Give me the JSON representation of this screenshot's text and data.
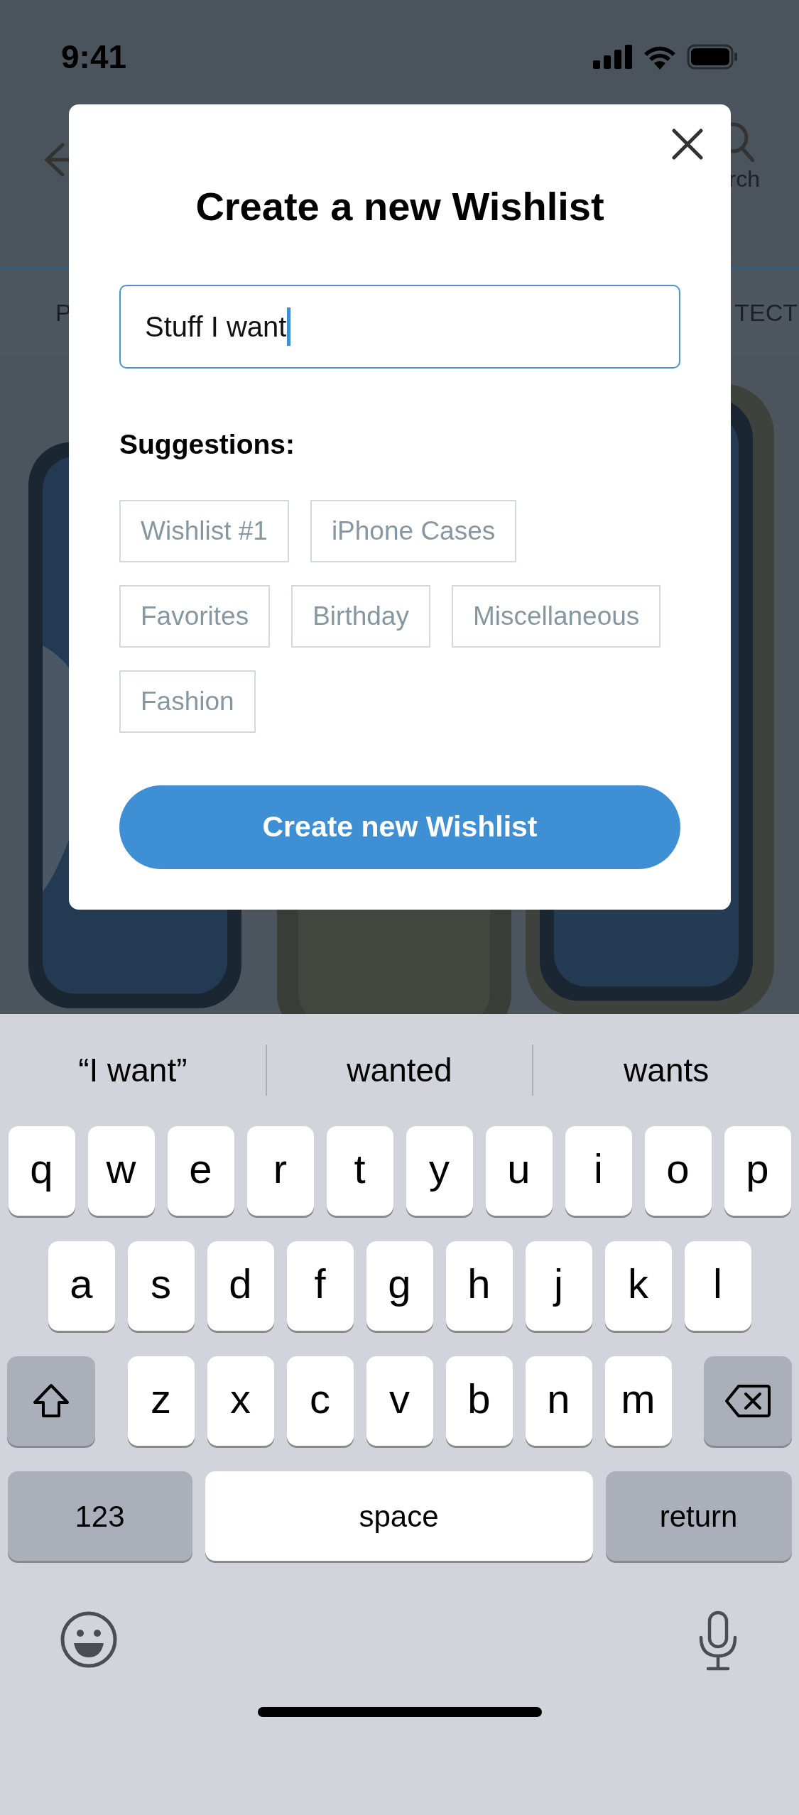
{
  "status_bar": {
    "time": "9:41"
  },
  "background": {
    "header": {
      "search_label": "rch"
    },
    "tabs": [
      {
        "label": "P"
      },
      {
        "label": "TECT"
      }
    ]
  },
  "dialog": {
    "title": "Create a new Wishlist",
    "name_field": {
      "value": "Stuff I want"
    },
    "suggestions_label": "Suggestions:",
    "suggestions": [
      [
        "Wishlist #1",
        "iPhone Cases"
      ],
      [
        "Favorites",
        "Birthday",
        "Miscellaneous"
      ],
      [
        "Fashion"
      ]
    ],
    "button": "Create new Wishlist"
  },
  "keyboard": {
    "predictions": [
      "“I want”",
      "wanted",
      "wants"
    ],
    "rows": [
      [
        {
          "kind": "letter",
          "label": "q"
        },
        {
          "kind": "letter",
          "label": "w"
        },
        {
          "kind": "letter",
          "label": "e"
        },
        {
          "kind": "letter",
          "label": "r"
        },
        {
          "kind": "letter",
          "label": "t"
        },
        {
          "kind": "letter",
          "label": "y"
        },
        {
          "kind": "letter",
          "label": "u"
        },
        {
          "kind": "letter",
          "label": "i"
        },
        {
          "kind": "letter",
          "label": "o"
        },
        {
          "kind": "letter",
          "label": "p"
        }
      ],
      [
        {
          "kind": "letter",
          "label": "a"
        },
        {
          "kind": "letter",
          "label": "s"
        },
        {
          "kind": "letter",
          "label": "d"
        },
        {
          "kind": "letter",
          "label": "f"
        },
        {
          "kind": "letter",
          "label": "g"
        },
        {
          "kind": "letter",
          "label": "h"
        },
        {
          "kind": "letter",
          "label": "j"
        },
        {
          "kind": "letter",
          "label": "k"
        },
        {
          "kind": "letter",
          "label": "l"
        }
      ],
      [
        {
          "kind": "shift"
        },
        {
          "kind": "letter",
          "label": "z"
        },
        {
          "kind": "letter",
          "label": "x"
        },
        {
          "kind": "letter",
          "label": "c"
        },
        {
          "kind": "letter",
          "label": "v"
        },
        {
          "kind": "letter",
          "label": "b"
        },
        {
          "kind": "letter",
          "label": "n"
        },
        {
          "kind": "letter",
          "label": "m"
        },
        {
          "kind": "delete"
        }
      ]
    ],
    "bottom_row": [
      {
        "kind": "mode",
        "label": "123"
      },
      {
        "kind": "space",
        "label": "space"
      },
      {
        "kind": "return",
        "label": "return"
      }
    ]
  }
}
